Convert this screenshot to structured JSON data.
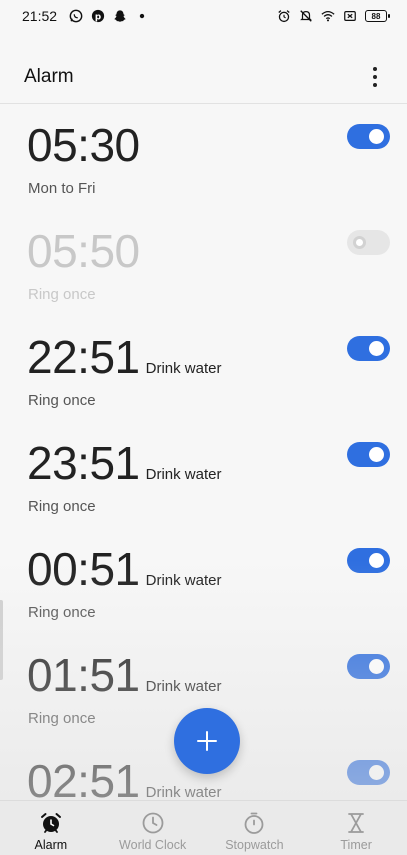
{
  "status_bar": {
    "time": "21:52",
    "battery": "88",
    "icons_left": [
      "whatsapp-icon",
      "pinterest-icon",
      "snapchat-icon",
      "dot-icon"
    ],
    "icons_right": [
      "alarm-clock-icon",
      "bell-muted-icon",
      "wifi-icon",
      "sim-off-icon",
      "battery-icon"
    ]
  },
  "app_bar": {
    "title": "Alarm",
    "more_icon": "more-vertical-icon"
  },
  "alarms": [
    {
      "time": "05:30",
      "label": "",
      "repeat": "Mon to Fri",
      "enabled": true
    },
    {
      "time": "05:50",
      "label": "",
      "repeat": "Ring once",
      "enabled": false
    },
    {
      "time": "22:51",
      "label": "Drink water",
      "repeat": "Ring once",
      "enabled": true
    },
    {
      "time": "23:51",
      "label": "Drink water",
      "repeat": "Ring once",
      "enabled": true
    },
    {
      "time": "00:51",
      "label": "Drink water",
      "repeat": "Ring once",
      "enabled": true
    },
    {
      "time": "01:51",
      "label": "Drink water",
      "repeat": "Ring once",
      "enabled": true
    },
    {
      "time": "02:51",
      "label": "Drink water",
      "repeat": "",
      "enabled": true
    }
  ],
  "fab": {
    "icon": "plus-icon"
  },
  "bottom_nav": [
    {
      "label": "Alarm",
      "icon": "alarm-clock-icon",
      "active": true
    },
    {
      "label": "World Clock",
      "icon": "clock-icon",
      "active": false
    },
    {
      "label": "Stopwatch",
      "icon": "stopwatch-icon",
      "active": false
    },
    {
      "label": "Timer",
      "icon": "hourglass-icon",
      "active": false
    }
  ],
  "colors": {
    "accent": "#2f6fe0",
    "toggle_off": "#e6e6e6",
    "text_primary": "#222222",
    "text_disabled": "#c8c8c8",
    "nav_inactive": "#9b9b9b"
  }
}
